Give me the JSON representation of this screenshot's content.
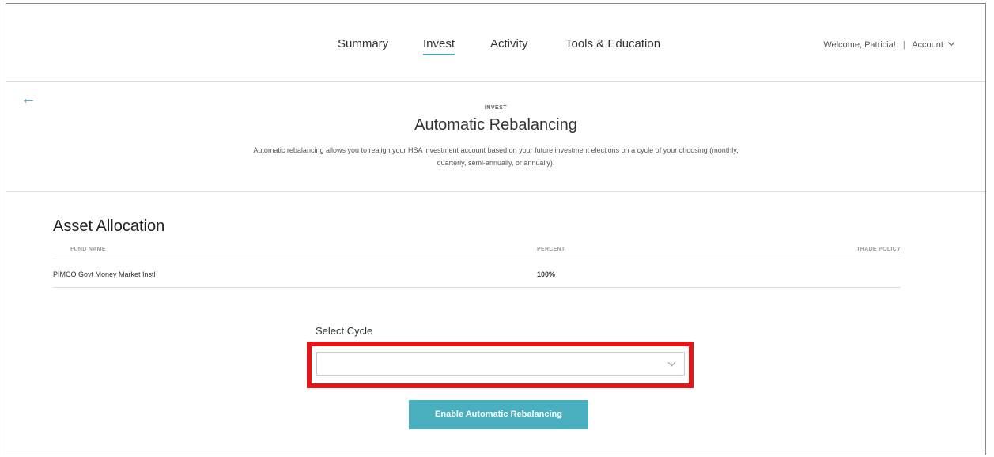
{
  "nav": {
    "links": [
      "Summary",
      "Invest",
      "Activity",
      "Tools & Education"
    ],
    "active": "Invest",
    "welcome": "Welcome, Patricia!",
    "separator": "|",
    "account_label": "Account"
  },
  "header": {
    "back_icon": "arrow-left-icon",
    "eyebrow": "INVEST",
    "title": "Automatic Rebalancing",
    "description": "Automatic rebalancing allows you to realign your HSA investment account based on your future investment elections on a cycle of your choosing (monthly, quarterly, semi-annually, or annually)."
  },
  "asset_allocation": {
    "title": "Asset Allocation",
    "columns": [
      "FUND NAME",
      "PERCENT",
      "TRADE POLICY"
    ],
    "rows": [
      {
        "fund": "PIMCO Govt Money Market Instl",
        "percent": "100%",
        "trade_policy": ""
      }
    ]
  },
  "cycle": {
    "label": "Select Cycle",
    "selected_value": ""
  },
  "actions": {
    "enable_label": "Enable Automatic Rebalancing"
  },
  "colors": {
    "accent": "#4aafbf",
    "highlight": "#e3161b"
  }
}
